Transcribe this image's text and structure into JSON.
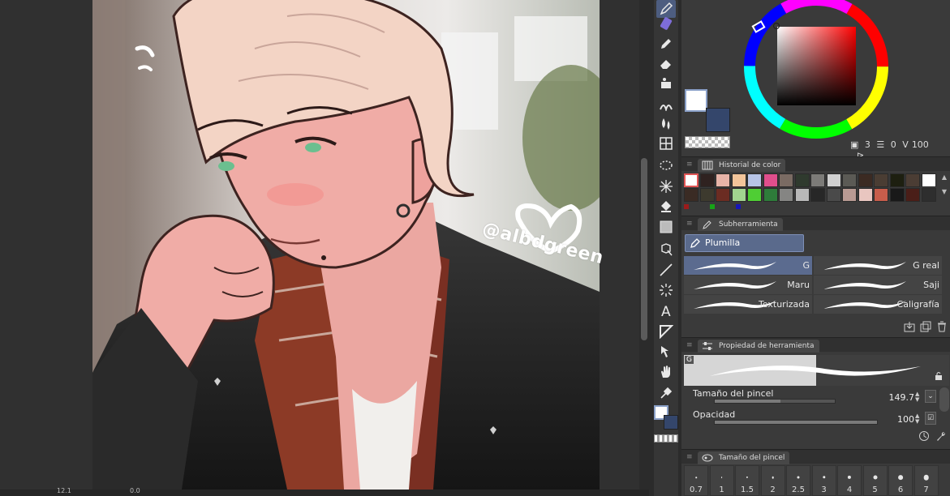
{
  "watermark": "@albdgreen",
  "statusbar": {
    "zoom": "12.1",
    "rotation": "0.0"
  },
  "color": {
    "main": "#ffffff",
    "sub": "#34466b",
    "readout": {
      "layer": "3",
      "a": "0",
      "v": "100"
    }
  },
  "panels": {
    "history_title": "Historial de color",
    "subtool_title": "Subherramienta",
    "property_title": "Propiedad de herramienta",
    "brushsize_title": "Tamaño del pincel"
  },
  "history_colors": [
    "#ffffff",
    "#2f2220",
    "#e8b4a8",
    "#f3c59a",
    "#b7c4e6",
    "#e04e8c",
    "#7a6b63",
    "#2f3a2e",
    "#7c7b78",
    "#d0d0d0",
    "#5b5a55",
    "#3b2a22",
    "#4a3d33",
    "#1d1f10",
    "#4b3d34",
    "#ffffff",
    "#3a2b24",
    "#3d3a2e",
    "#6b2c22",
    "#a1d48f",
    "#4fce34",
    "#2e7c3a",
    "#858583",
    "#b8b8b8",
    "#272727",
    "#4a4a4a",
    "#b89a93",
    "#e9c6c0",
    "#c75d4b",
    "#191919",
    "#4a1e18",
    "#2e2e2e"
  ],
  "subtool": {
    "group": "Plumilla",
    "brushes": [
      {
        "label": "G",
        "selected": true
      },
      {
        "label": "G real",
        "selected": false
      },
      {
        "label": "Maru",
        "selected": false
      },
      {
        "label": "Saji",
        "selected": false
      },
      {
        "label": "Texturizada",
        "selected": false
      },
      {
        "label": "Caligrafía",
        "selected": false
      }
    ]
  },
  "property": {
    "brush_name_tag": "G",
    "size_label": "Tamaño del pincel",
    "size_value": "149.7",
    "size_fraction": 0.55,
    "opacity_label": "Opacidad",
    "opacity_value": "100",
    "opacity_fraction": 1.0
  },
  "size_presets": [
    "0.7",
    "1",
    "1.5",
    "2",
    "2.5",
    "3",
    "4",
    "5",
    "6",
    "7"
  ],
  "icons": [
    "pen-icon",
    "marker-icon",
    "pencil-icon",
    "eraser-icon",
    "fill-icon",
    "airbrush-icon",
    "blend-icon",
    "grid-icon",
    "lasso-icon",
    "magic-wand-icon",
    "bucket-icon",
    "gradient-icon",
    "object-icon",
    "line-icon",
    "burst-icon",
    "text-icon",
    "frame-icon",
    "operation-icon",
    "hand-icon",
    "eyedropper-icon"
  ]
}
